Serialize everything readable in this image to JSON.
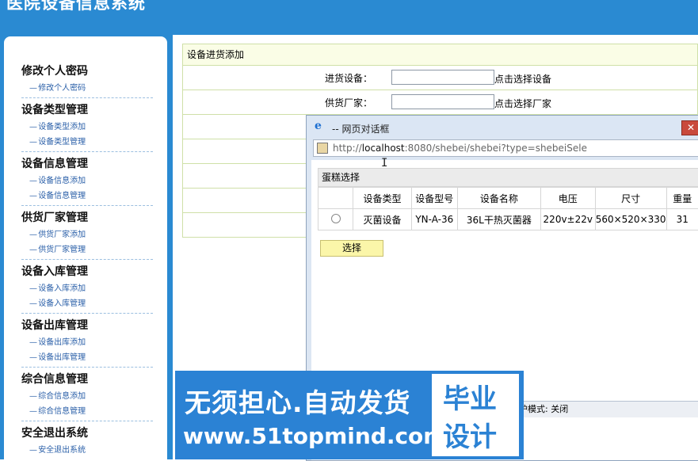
{
  "header": {
    "title": "医院设备信息系统"
  },
  "sidebar": {
    "groups": [
      {
        "title": "修改个人密码",
        "items": [
          "修改个人密码"
        ]
      },
      {
        "title": "设备类型管理",
        "items": [
          "设备类型添加",
          "设备类型管理"
        ]
      },
      {
        "title": "设备信息管理",
        "items": [
          "设备信息添加",
          "设备信息管理"
        ]
      },
      {
        "title": "供货厂家管理",
        "items": [
          "供货厂家添加",
          "供货厂家管理"
        ]
      },
      {
        "title": "设备入库管理",
        "items": [
          "设备入库添加",
          "设备入库管理"
        ]
      },
      {
        "title": "设备出库管理",
        "items": [
          "设备出库添加",
          "设备出库管理"
        ]
      },
      {
        "title": "综合信息管理",
        "items": [
          "综合信息添加",
          "综合信息管理"
        ]
      },
      {
        "title": "安全退出系统",
        "items": [
          "安全退出系统"
        ]
      }
    ]
  },
  "main": {
    "heading": "设备进货添加",
    "fields": [
      {
        "label": "进货设备：",
        "value": "",
        "link": "点击选择设备"
      },
      {
        "label": "供货厂家：",
        "value": "",
        "link": "点击选择厂家"
      }
    ]
  },
  "dialog": {
    "title": "-- 网页对话框",
    "close": "✕",
    "url_prefix": "http://",
    "url_host": "localhost",
    "url_rest": ":8080/shebei/shebei?type=shebeiSele",
    "caption": "蛋糕选择",
    "columns": [
      "",
      "设备类型",
      "设备型号",
      "设备名称",
      "电压",
      "尺寸",
      "重量"
    ],
    "rows": [
      [
        "",
        "灭菌设备",
        "YN-A-36",
        "36L干热灭菌器",
        "220v±22v",
        "560×520×330",
        "31"
      ]
    ],
    "select_button": "选择",
    "status": "护模式: 关闭"
  },
  "watermark": {
    "line1": "无须担心.自动发货",
    "line2": "www.51topmind.com",
    "box1": "毕业",
    "box2": "设计"
  },
  "colors": {
    "accent": "#2a8ad2",
    "form_border": "#cfe0a8"
  }
}
